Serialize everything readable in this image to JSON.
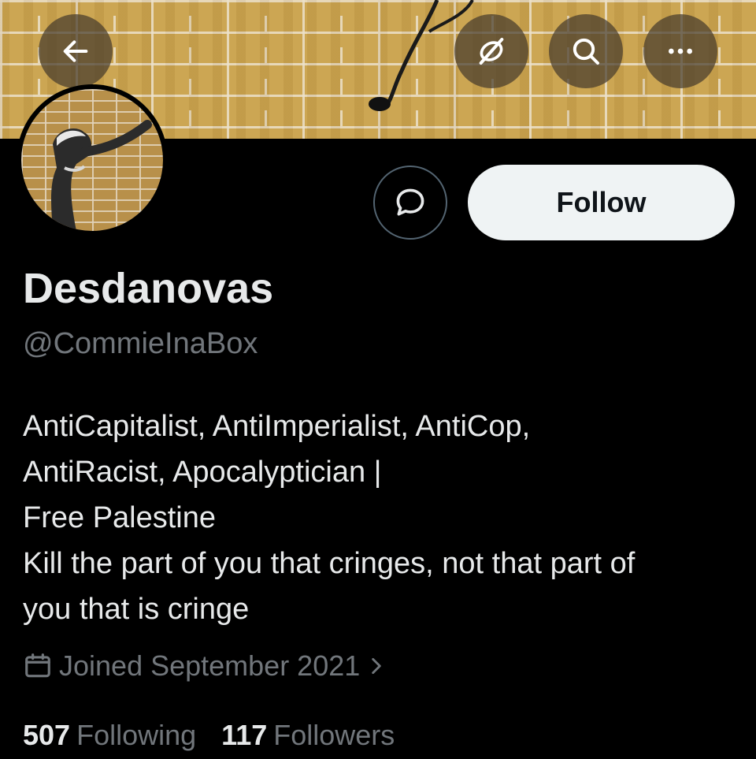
{
  "header": {
    "back_icon": "arrow-left-icon",
    "translate_icon": "link-slash-icon",
    "search_icon": "search-icon",
    "more_icon": "more-horizontal-icon"
  },
  "profile": {
    "display_name": "Desdanovas",
    "handle": "@CommieInaBox",
    "bio": "AntiCapitalist, AntiImperialist, AntiCop,\nAntiRacist, Apocalyptician |\nFree Palestine\nKill the part of you that cringes, not that part of\nyou that is cringe",
    "joined": "Joined September 2021",
    "following_count": "507",
    "following_label": "Following",
    "followers_count": "117",
    "followers_label": "Followers"
  },
  "actions": {
    "message_icon": "message-bubble-icon",
    "follow_label": "Follow"
  },
  "colors": {
    "background": "#000000",
    "primary_text": "#e7e9ea",
    "secondary_text": "#71767b",
    "follow_button_bg": "#eff3f4",
    "follow_button_text": "#0f1419"
  }
}
